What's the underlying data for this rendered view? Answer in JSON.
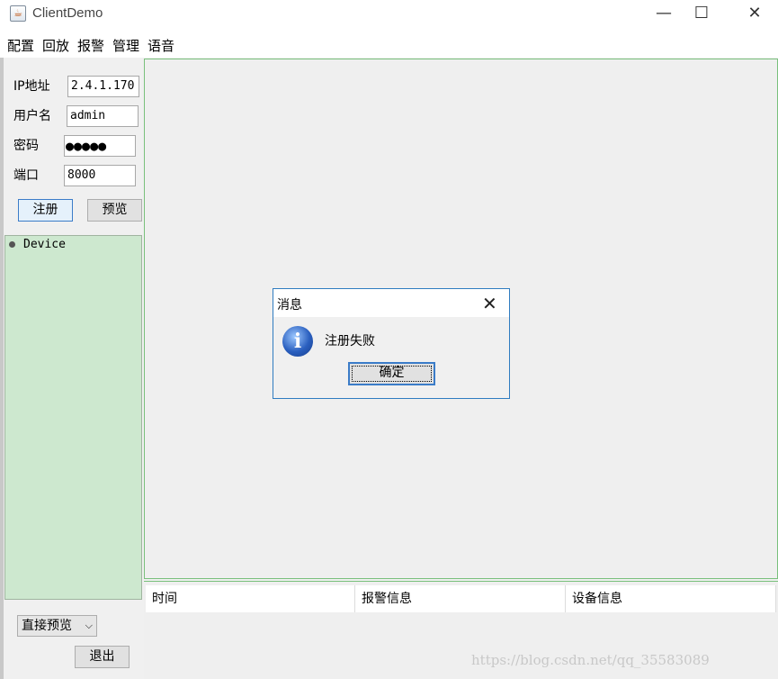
{
  "window": {
    "title": "ClientDemo",
    "minimize_glyph": "—",
    "maximize_glyph": "☐",
    "close_glyph": "✕",
    "app_icon": "java-cup-icon"
  },
  "menu": [
    "配置",
    "回放",
    "报警",
    "管理",
    "语音"
  ],
  "login": {
    "ip_label": "IP地址",
    "ip_value": "2.4.1.170",
    "user_label": "用户名",
    "user_value": "admin",
    "password_label": "密码",
    "password_value": "●●●●●",
    "port_label": "端口",
    "port_value": "8000",
    "register_button": "注册",
    "preview_button": "预览"
  },
  "tree": {
    "root_label": "Device"
  },
  "bottom_left": {
    "preview_mode": "直接预览",
    "exit_button": "退出"
  },
  "table": {
    "columns": [
      "时间",
      "报警信息",
      "设备信息"
    ]
  },
  "dialog": {
    "title": "消息",
    "message": "注册失败",
    "ok_button": "确定",
    "icon": "info-icon"
  },
  "watermark": "https://blog.csdn.net/qq_35583089",
  "colors": {
    "tree_bg": "#cde8cf",
    "panel_border": "#79c07c",
    "dialog_border": "#2f7cc0"
  }
}
